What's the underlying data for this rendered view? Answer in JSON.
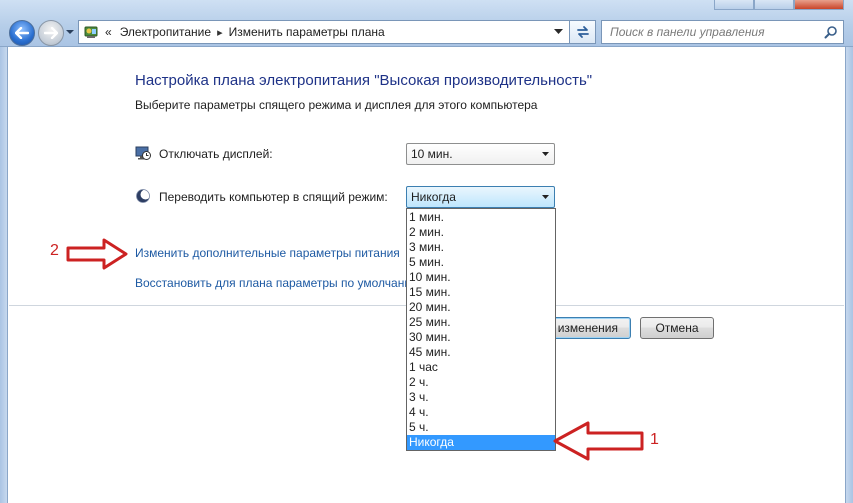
{
  "address_bar": {
    "crumbs": [
      "Электропитание",
      "Изменить параметры плана"
    ],
    "overflow_glyph": "«",
    "separator_glyph": "▸"
  },
  "search": {
    "placeholder": "Поиск в панели управления"
  },
  "page": {
    "title": "Настройка плана электропитания \"Высокая производительность\"",
    "subtitle": "Выберите параметры спящего режима и дисплея для этого компьютера"
  },
  "settings": {
    "display_off": {
      "label": "Отключать дисплей:",
      "value": "10 мин.",
      "icon": "monitor-clock-icon"
    },
    "sleep": {
      "label": "Переводить компьютер в спящий режим:",
      "value": "Никогда",
      "icon": "moon-icon"
    }
  },
  "links": {
    "advanced": "Изменить дополнительные параметры питания",
    "restore": "Восстановить для плана параметры по умолчанию"
  },
  "buttons": {
    "save": "Сохранить изменения",
    "cancel": "Отмена"
  },
  "sleep_options": [
    "1 мин.",
    "2 мин.",
    "3 мин.",
    "5 мин.",
    "10 мин.",
    "15 мин.",
    "20 мин.",
    "25 мин.",
    "30 мин.",
    "45 мин.",
    "1 час",
    "2 ч.",
    "3 ч.",
    "4 ч.",
    "5 ч.",
    "Никогда"
  ],
  "sleep_selected_index": 15,
  "annotations": [
    {
      "number": "1",
      "target": "sleep-option-never"
    },
    {
      "number": "2",
      "target": "advanced-settings-link"
    }
  ],
  "colors": {
    "title": "#1e3287",
    "link": "#1e5aa3",
    "selection": "#3399ff",
    "annotation": "#cc2222",
    "frame": "#b6cee9"
  }
}
